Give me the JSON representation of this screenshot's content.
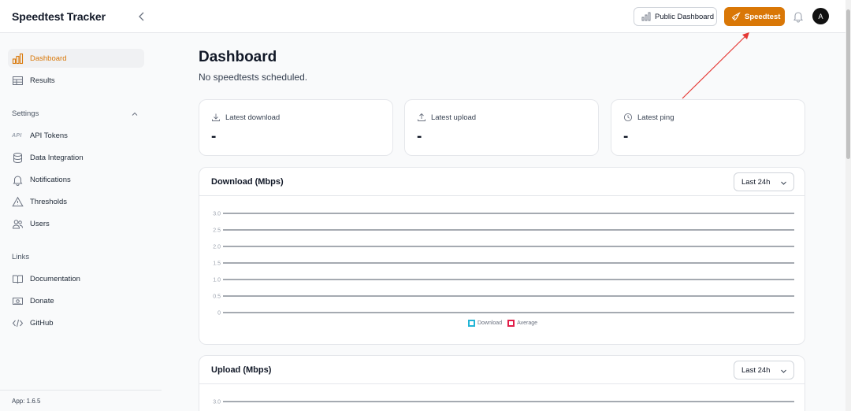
{
  "app": {
    "title": "Speedtest Tracker"
  },
  "header": {
    "public_dashboard_label": "Public Dashboard",
    "speedtest_label": "Speedtest",
    "avatar_initial": "A"
  },
  "sidebar": {
    "main_items": [
      {
        "label": "Dashboard",
        "icon": "chart-bar-icon"
      },
      {
        "label": "Results",
        "icon": "table-icon"
      }
    ],
    "settings_label": "Settings",
    "settings_items": [
      {
        "label": "API Tokens",
        "icon": "api-icon",
        "glyph": "API"
      },
      {
        "label": "Data Integration",
        "icon": "database-icon"
      },
      {
        "label": "Notifications",
        "icon": "bell-icon"
      },
      {
        "label": "Thresholds",
        "icon": "warning-icon"
      },
      {
        "label": "Users",
        "icon": "users-icon"
      }
    ],
    "links_label": "Links",
    "links_items": [
      {
        "label": "Documentation",
        "icon": "book-icon"
      },
      {
        "label": "Donate",
        "icon": "banknote-icon"
      },
      {
        "label": "GitHub",
        "icon": "code-icon"
      }
    ],
    "app_version": "App: 1.6.5"
  },
  "main": {
    "title": "Dashboard",
    "subtitle": "No speedtests scheduled.",
    "stats": [
      {
        "label": "Latest download",
        "value": "-"
      },
      {
        "label": "Latest upload",
        "value": "-"
      },
      {
        "label": "Latest ping",
        "value": "-"
      }
    ]
  },
  "colors": {
    "accent": "#d97706",
    "download_series": "#22b5d6",
    "average_series": "#e11d48",
    "annotation_arrow": "#e53935"
  },
  "chart_data": [
    {
      "type": "line",
      "title": "Download (Mbps)",
      "range_selector": "Last 24h",
      "yticks": [
        "3.0",
        "2.5",
        "2.0",
        "1.5",
        "1.0",
        "0.5",
        "0"
      ],
      "ylim": [
        0,
        3.0
      ],
      "grid": true,
      "legend_position": "bottom",
      "series": [
        {
          "name": "Download",
          "values": []
        },
        {
          "name": "Average",
          "values": []
        }
      ]
    },
    {
      "type": "line",
      "title": "Upload (Mbps)",
      "range_selector": "Last 24h",
      "yticks": [
        "3.0"
      ],
      "grid": true
    }
  ]
}
